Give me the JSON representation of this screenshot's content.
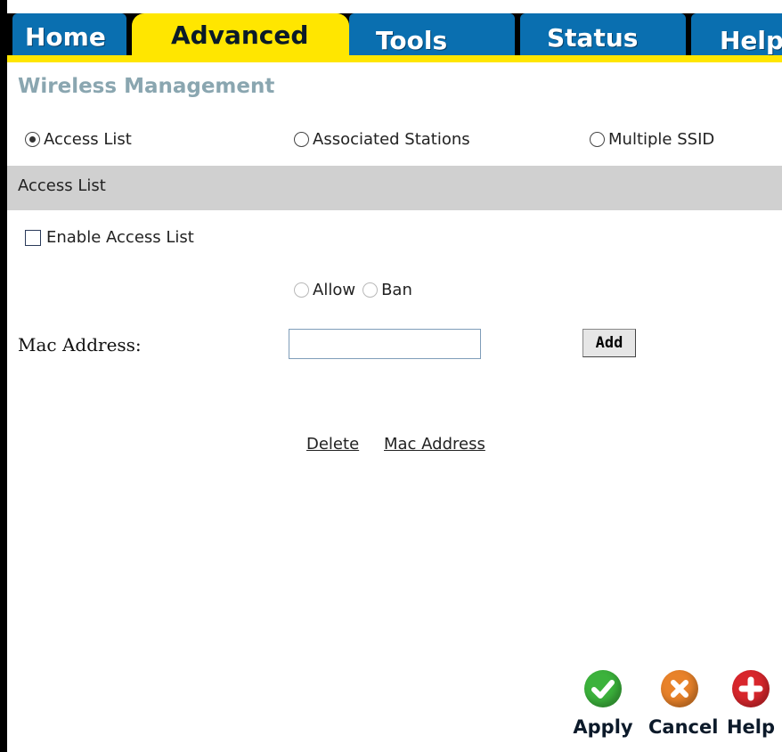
{
  "tabs": [
    {
      "label": "Home"
    },
    {
      "label": "Advanced",
      "active": true
    },
    {
      "label": "Tools"
    },
    {
      "label": "Status"
    },
    {
      "label": "Help"
    }
  ],
  "page_title": "Wireless Management",
  "mode_options": {
    "access_list": "Access List",
    "associated_stations": "Associated Stations",
    "multiple_ssid": "Multiple SSID",
    "selected": "Access List"
  },
  "section_title": "Access List",
  "enable_access_list": {
    "label": "Enable Access List",
    "checked": false
  },
  "policy": {
    "allow_label": "Allow",
    "ban_label": "Ban"
  },
  "mac_address": {
    "label": "Mac Address:",
    "value": "",
    "add_label": "Add"
  },
  "table": {
    "headers": [
      "Delete",
      "Mac Address"
    ]
  },
  "actions": {
    "apply": "Apply",
    "cancel": "Cancel",
    "help": "Help"
  },
  "colors": {
    "tab_blue": "#0a6fb0",
    "tab_active_yellow": "#ffe600",
    "section_gray": "#d0d0d0",
    "apply_green": "#3cb23c",
    "cancel_orange": "#e8822a",
    "help_red": "#d8262c"
  },
  "icons": {
    "apply": "check-icon",
    "cancel": "x-icon",
    "help": "plus-icon"
  }
}
